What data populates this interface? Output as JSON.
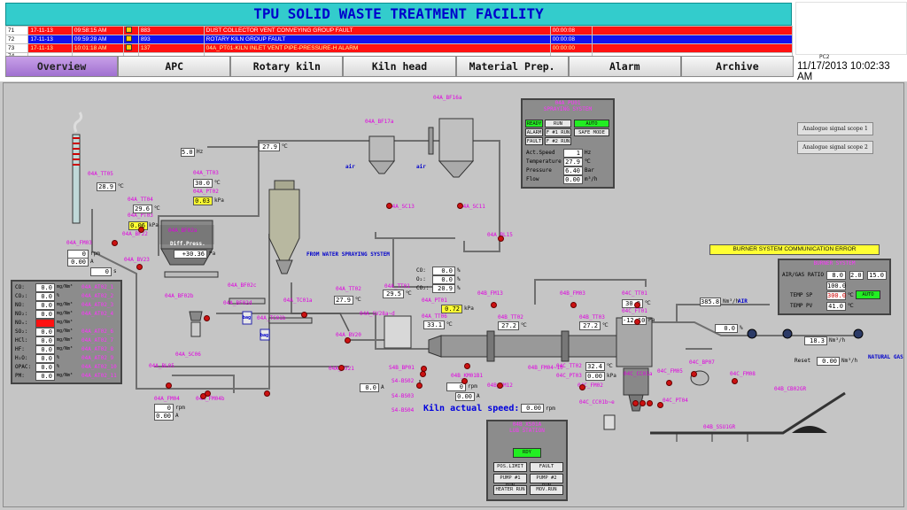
{
  "header": {
    "title": "TPU SOLID WASTE TREATMENT FACILITY",
    "pc_label": "PC2",
    "clock": "11/17/2013 10:02:33 AM"
  },
  "alarms": [
    {
      "no": "71",
      "date": "17-11-13",
      "time": "09:58:15 AM",
      "code": "883",
      "text": "DUST COLLECTOR VENT CONVEYING GROUP FAULT",
      "duration": "00:00:08",
      "bg": "#ff1111",
      "fg": "#ffffff"
    },
    {
      "no": "72",
      "date": "17-11-13",
      "time": "09:59:28 AM",
      "code": "893",
      "text": "ROTARY KILN GROUP FAULT",
      "duration": "00:00:08",
      "bg": "#1111ee",
      "fg": "#ffffff"
    },
    {
      "no": "73",
      "date": "17-11-13",
      "time": "10:01:18 AM",
      "code": "137",
      "text": "04A_PT01-KILN INLET VENT PIPE-PRESSURE-H ALARM",
      "duration": "00:00:00",
      "bg": "#ff1111",
      "fg": "#ffff99"
    },
    {
      "no": "74",
      "date": "",
      "time": "",
      "code": "",
      "text": "",
      "duration": "",
      "bg": "#ffffff",
      "fg": "#000000"
    }
  ],
  "nav": [
    "Overview",
    "APC",
    "Rotary kiln",
    "Kiln head",
    "Material Prep.",
    "Alarm",
    "Archive"
  ],
  "nav_active": "Overview",
  "spraying_panel": {
    "tag": "04A_PU01",
    "title": "SPRAYING SYSTEM",
    "buttons": [
      "READY",
      "RUN",
      "AUTO",
      "ALARM",
      "F #1 RUN",
      "SAFE MODE",
      "FAULT",
      "F #2 RUN"
    ],
    "rows": [
      {
        "label": "Act.Speed",
        "value": "1",
        "unit": "Hz"
      },
      {
        "label": "Temperature",
        "value": "27.9",
        "unit": "℃"
      },
      {
        "label": "Pressure",
        "value": "6.40",
        "unit": "Bar"
      },
      {
        "label": "Flow",
        "value": "0.00",
        "unit": "m³/h"
      }
    ]
  },
  "scopes": [
    "Analogue signal scope 1",
    "Analogue signal scope 2"
  ],
  "burner": {
    "error": "BURNER SYSTEM COMMUNICATION ERROR",
    "title": "BURNER SYSTEM",
    "ratio_label": "AIR/GAS RATIO",
    "ratio_value": "8.0",
    "ratio_min": "2.0",
    "ratio_max": "15.0",
    "ratio2": "100.0",
    "sp_label": "TEMP SP",
    "sp_value": "300.0",
    "sp_unit": "℃",
    "pv_label": "TEMP PV",
    "pv_value": "41.0",
    "pv_unit": "℃",
    "auto_label": "AUTO"
  },
  "gas_panel": {
    "rows": [
      {
        "label": "CO:",
        "value": "0.0",
        "unit": "mg/Nm³",
        "tag": "04A_AT02_1",
        "alarm": false
      },
      {
        "label": "CO₂:",
        "value": "0.0",
        "unit": "%",
        "tag": "04A_AT02_2",
        "alarm": false
      },
      {
        "label": "NO:",
        "value": "0.0",
        "unit": "mg/Nm³",
        "tag": "04A_AT02_3",
        "alarm": false
      },
      {
        "label": "NO₂:",
        "value": "0.0",
        "unit": "mg/Nm³",
        "tag": "04A_AT02_4",
        "alarm": false
      },
      {
        "label": "NOₓ:",
        "value": "",
        "unit": "mg/Nm³",
        "tag": "",
        "alarm": true
      },
      {
        "label": "SO₂:",
        "value": "0.0",
        "unit": "mg/Nm³",
        "tag": "04A_AT02_6",
        "alarm": false
      },
      {
        "label": "HCl:",
        "value": "0.0",
        "unit": "mg/Nm³",
        "tag": "04A_AT02_7",
        "alarm": false
      },
      {
        "label": "HF:",
        "value": "0.0",
        "unit": "mg/Nm³",
        "tag": "04A_AT02_8",
        "alarm": false
      },
      {
        "label": "H₂O:",
        "value": "0.0",
        "unit": "%",
        "tag": "04A_AT02_9",
        "alarm": false
      },
      {
        "label": "OPAC:",
        "value": "0.0",
        "unit": "%",
        "tag": "04A_AT02_10",
        "alarm": false
      },
      {
        "label": "PM:",
        "value": "0.0",
        "unit": "mg/Nm³",
        "tag": "04A_AT02_11",
        "alarm": false
      }
    ]
  },
  "lub_panel": {
    "tag": "04B_XS01A",
    "title": "LUB STATION",
    "status": "RDY",
    "buttons": [
      "POS.LIMIT",
      "FAULT",
      "PUMP #1 RUN",
      "PUMP #2 RUN",
      "HEATER RUN",
      "MOV.RUN"
    ]
  },
  "o2_block": {
    "rows": [
      {
        "label": "CO:",
        "value": "0.0",
        "unit": "%"
      },
      {
        "label": "O₂:",
        "value": "0.0",
        "unit": "%"
      },
      {
        "label": "CO₂:",
        "value": "20.9",
        "unit": "%"
      }
    ]
  },
  "kiln_speed": {
    "label": "Kiln actual speed:",
    "value": "0.00",
    "unit": "rpm"
  },
  "labels": {
    "spray_system": "FROM WATER SPRAYING SYSTEM",
    "diff_press": "Diff.Press.",
    "air": "AIR",
    "natural_gas": "NATURAL GAS",
    "reset": "Reset",
    "air_left1": "air",
    "air_left2": "air",
    "bag": "bag"
  },
  "tags": {
    "t_tt05": "04A_TT05",
    "t_tt04": "04A_TT04",
    "t_pt03": "04A_PT03",
    "t_fm03": "04A_FM03",
    "t_bf22": "04A_BF22",
    "t_bv23": "04A_BV23",
    "t_bf02b": "04A_BF02b",
    "t_tt03": "04A_TT03",
    "t_pt02": "04A_PT02",
    "t_bf02a": "04A_BF02a",
    "t_bf02c": "04A_BF02c",
    "t_bf02d": "04A_BF02d",
    "t_sc06": "04A_SC06",
    "t_bl05": "04A_BL05",
    "t_fm04": "04A_FM04",
    "t_fm04b": "04A_FM04b",
    "t_tc01a": "04A_TC01a",
    "t_tc01b": "04A_TC01b",
    "t_bf16a": "04A_BF16a",
    "t_bf17a": "04A_BF17a",
    "t_sc13": "04A_SC13",
    "t_sc11": "04A_SC11",
    "t_bl15": "04A_BL15",
    "t_tt02": "04A_TT02",
    "t_tt01": "04A_TT01",
    "t_sv28": "04A_SV28a~d",
    "t_bv20": "04A_BV20",
    "t_bv21": "04A_BV21",
    "t_pt01": "04A_PT01",
    "t_tt06": "04A_TT06",
    "t_fm13": "04B_FM13",
    "t_tt02b": "04B_TT02",
    "t_fm03b": "04B_FM03",
    "t_tt03b": "04B_TT03",
    "t_fm12": "04B_FM12",
    "t_km01": "04B_KM01B1",
    "t_tt01c": "04C_TT01",
    "t_ft01c": "04C_FT01",
    "t_tt02c": "04C_TT02",
    "t_pt03c": "04C_PT03",
    "t_cc01a": "04C_CC01a",
    "t_cc01b": "04C_CC01b~e",
    "t_fm02c": "04C_FM02",
    "t_fm05c": "04C_FM05",
    "t_bp07": "04C_BP07",
    "t_fm08c": "04C_FM08",
    "t_pt04c": "04C_PT04",
    "t_ssu1gr": "04B_SSU1GR",
    "t_cb02gr": "04B_CB02GR",
    "t_bp01": "S4B_BP01",
    "t_bs02": "S4-BS02",
    "t_bs03": "S4-BS03",
    "t_bs04": "S4-BS04",
    "t_fm04b2": "04B_FM04~10"
  },
  "values": {
    "v_tt05": "28.9",
    "v_tt04": "29.6",
    "v_pt03": "0.06",
    "v_f1": "0",
    "v_f2": "0.00",
    "v_f3": "0",
    "v_rpm5": "5.0",
    "v_tt03": "30.0",
    "v_pt02": "0.03",
    "v_top": "27.9",
    "v_diff": "+30.36",
    "v_tt02": "27.9",
    "v_tt01": "29.5",
    "v_pt01": "0.72",
    "v_tt06": "33.1",
    "v_fm04a": "0",
    "v_fm04b": "0.00",
    "v_bv21": "0.0",
    "v_km01a": "0",
    "v_km01b": "0.00",
    "v_tt02b": "27.2",
    "v_tt03b": "27.2",
    "v_tt01c": "30.9",
    "v_ft01c": "-12.10",
    "v_tt02c": "32.4",
    "v_pt03c": "0.00",
    "v_air": "385.8",
    "v_air2": "0.0",
    "v_gas": "18.3",
    "v_reset": "0.00"
  },
  "units": {
    "u_c": "℃",
    "u_kpa": "kPa",
    "u_rpm": "rpm",
    "u_a": "A",
    "u_s": "s",
    "u_hz": "Hz",
    "u_nm3h": "Nm³/h",
    "u_pa": "Pa",
    "u_pct": "%"
  }
}
